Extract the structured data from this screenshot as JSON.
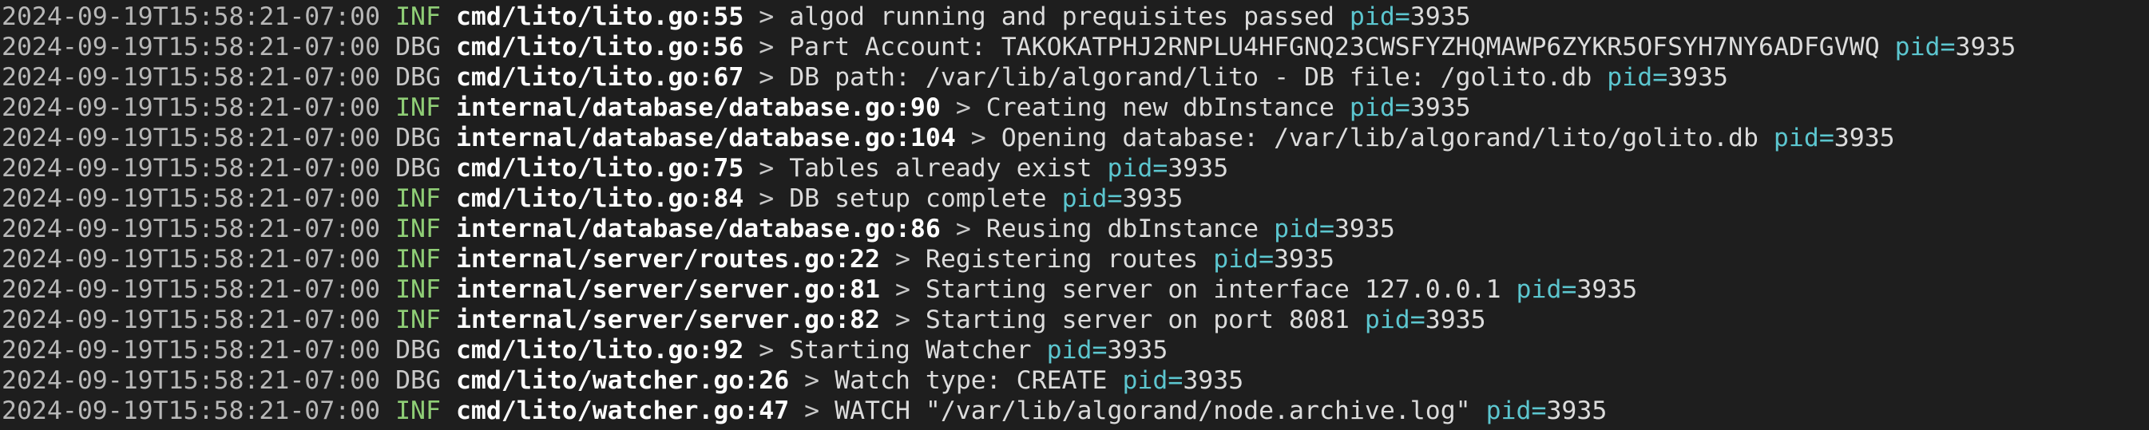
{
  "colors": {
    "background": "#1e1e1e",
    "timestamp": "#b8b8b8",
    "level_inf": "#8fce76",
    "level_dbg": "#c9c9c9",
    "source": "#ffffff",
    "pid_key": "#5cc6cf"
  },
  "log": {
    "lines": [
      {
        "timestamp": "2024-09-19T15:58:21-07:00",
        "level": "INF",
        "source": "cmd/lito/lito.go:55",
        "arrow": ">",
        "message": "algod running and prequisites passed",
        "pid_key": "pid=",
        "pid": "3935"
      },
      {
        "timestamp": "2024-09-19T15:58:21-07:00",
        "level": "DBG",
        "source": "cmd/lito/lito.go:56",
        "arrow": ">",
        "message": "Part Account: TAKOKATPHJ2RNPLU4HFGNQ23CWSFYZHQMAWP6ZYKR5OFSYH7NY6ADFGVWQ",
        "pid_key": "pid=",
        "pid": "3935"
      },
      {
        "timestamp": "2024-09-19T15:58:21-07:00",
        "level": "DBG",
        "source": "cmd/lito/lito.go:67",
        "arrow": ">",
        "message": "DB path: /var/lib/algorand/lito - DB file: /golito.db",
        "pid_key": "pid=",
        "pid": "3935"
      },
      {
        "timestamp": "2024-09-19T15:58:21-07:00",
        "level": "INF",
        "source": "internal/database/database.go:90",
        "arrow": ">",
        "message": "Creating new dbInstance",
        "pid_key": "pid=",
        "pid": "3935"
      },
      {
        "timestamp": "2024-09-19T15:58:21-07:00",
        "level": "DBG",
        "source": "internal/database/database.go:104",
        "arrow": ">",
        "message": "Opening database: /var/lib/algorand/lito/golito.db",
        "pid_key": "pid=",
        "pid": "3935"
      },
      {
        "timestamp": "2024-09-19T15:58:21-07:00",
        "level": "DBG",
        "source": "cmd/lito/lito.go:75",
        "arrow": ">",
        "message": "Tables already exist",
        "pid_key": "pid=",
        "pid": "3935"
      },
      {
        "timestamp": "2024-09-19T15:58:21-07:00",
        "level": "INF",
        "source": "cmd/lito/lito.go:84",
        "arrow": ">",
        "message": "DB setup complete",
        "pid_key": "pid=",
        "pid": "3935"
      },
      {
        "timestamp": "2024-09-19T15:58:21-07:00",
        "level": "INF",
        "source": "internal/database/database.go:86",
        "arrow": ">",
        "message": "Reusing dbInstance",
        "pid_key": "pid=",
        "pid": "3935"
      },
      {
        "timestamp": "2024-09-19T15:58:21-07:00",
        "level": "INF",
        "source": "internal/server/routes.go:22",
        "arrow": ">",
        "message": "Registering routes",
        "pid_key": "pid=",
        "pid": "3935"
      },
      {
        "timestamp": "2024-09-19T15:58:21-07:00",
        "level": "INF",
        "source": "internal/server/server.go:81",
        "arrow": ">",
        "message": "Starting server on interface 127.0.0.1",
        "pid_key": "pid=",
        "pid": "3935"
      },
      {
        "timestamp": "2024-09-19T15:58:21-07:00",
        "level": "INF",
        "source": "internal/server/server.go:82",
        "arrow": ">",
        "message": "Starting server on port 8081",
        "pid_key": "pid=",
        "pid": "3935"
      },
      {
        "timestamp": "2024-09-19T15:58:21-07:00",
        "level": "DBG",
        "source": "cmd/lito/lito.go:92",
        "arrow": ">",
        "message": "Starting Watcher",
        "pid_key": "pid=",
        "pid": "3935"
      },
      {
        "timestamp": "2024-09-19T15:58:21-07:00",
        "level": "DBG",
        "source": "cmd/lito/watcher.go:26",
        "arrow": ">",
        "message": "Watch type: CREATE",
        "pid_key": "pid=",
        "pid": "3935"
      },
      {
        "timestamp": "2024-09-19T15:58:21-07:00",
        "level": "INF",
        "source": "cmd/lito/watcher.go:47",
        "arrow": ">",
        "message": "WATCH \"/var/lib/algorand/node.archive.log\"",
        "pid_key": "pid=",
        "pid": "3935"
      }
    ]
  }
}
